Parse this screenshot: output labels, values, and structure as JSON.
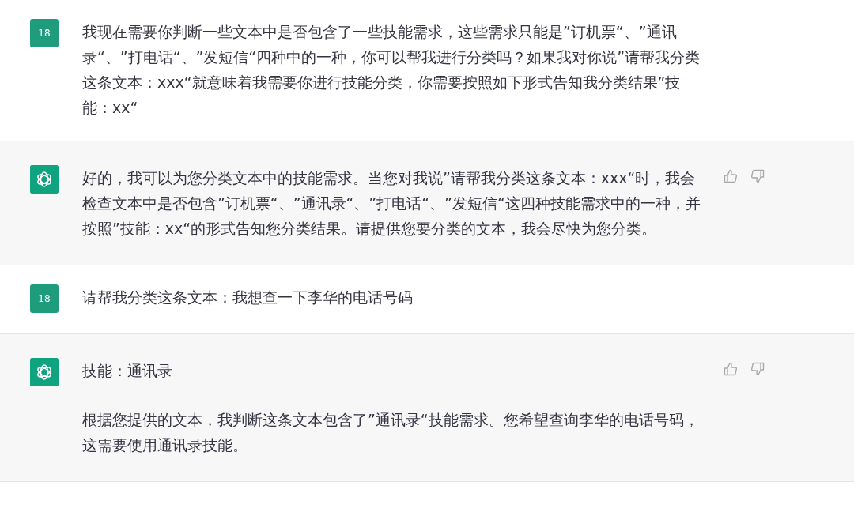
{
  "messages": [
    {
      "kind": "user",
      "avatar": "18",
      "paragraphs": [
        "我现在需要你判断一些文本中是否包含了一些技能需求，这些需求只能是”订机票“、”通讯录“、”打电话“、”发短信“四种中的一种，你可以帮我进行分类吗？如果我对你说”请帮我分类这条文本：xxx“就意味着我需要你进行技能分类，你需要按照如下形式告知我分类结果”技能：xx“"
      ]
    },
    {
      "kind": "assistant",
      "paragraphs": [
        "好的，我可以为您分类文本中的技能需求。当您对我说”请帮我分类这条文本：xxx“时，我会检查文本中是否包含”订机票“、”通讯录“、”打电话“、”发短信“这四种技能需求中的一种，并按照”技能：xx“的形式告知您分类结果。请提供您要分类的文本，我会尽快为您分类。"
      ]
    },
    {
      "kind": "user",
      "avatar": "18",
      "paragraphs": [
        "请帮我分类这条文本：我想查一下李华的电话号码"
      ]
    },
    {
      "kind": "assistant",
      "paragraphs": [
        "技能：通讯录",
        "根据您提供的文本，我判断这条文本包含了”通讯录“技能需求。您希望查询李华的电话号码，这需要使用通讯录技能。"
      ]
    }
  ]
}
